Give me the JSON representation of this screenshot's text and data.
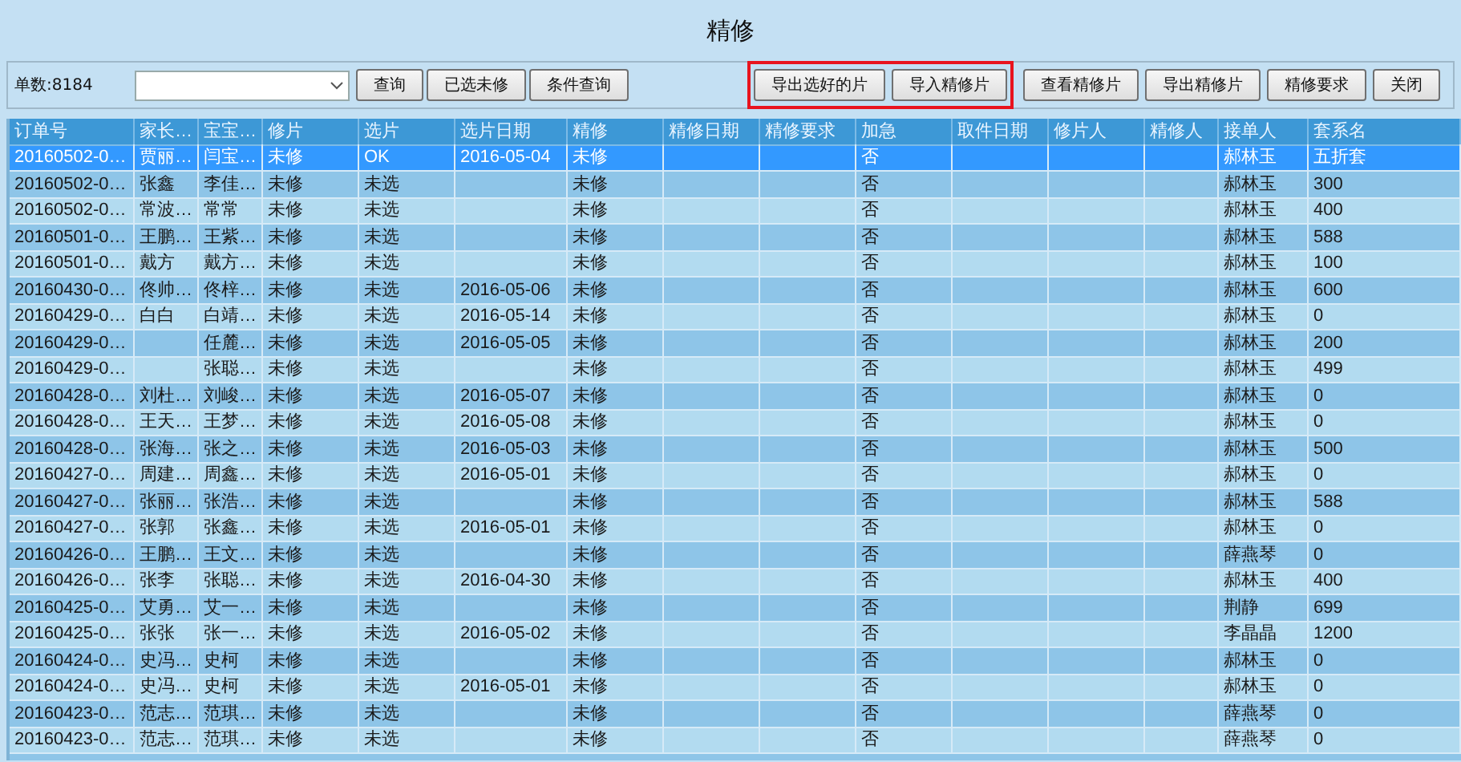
{
  "window": {
    "title": "精修"
  },
  "toolbar": {
    "count_label": "单数:8184",
    "left_buttons": [
      "查询",
      "已选未修",
      "条件查询"
    ],
    "right_groups": [
      {
        "highlighted": true,
        "buttons": [
          "导出选好的片",
          "导入精修片"
        ]
      },
      {
        "highlighted": false,
        "buttons": [
          "查看精修片",
          "导出精修片",
          "精修要求",
          "关闭"
        ]
      }
    ]
  },
  "table": {
    "columns": [
      "订单号",
      "家长…",
      "宝宝…",
      "修片",
      "选片",
      "选片日期",
      "精修",
      "精修日期",
      "精修要求",
      "加急",
      "取件日期",
      "修片人",
      "精修人",
      "接单人",
      "套系名"
    ],
    "rows": [
      {
        "selected": true,
        "cells": [
          "20160502-0…",
          "贾丽…",
          "闫宝…",
          "未修",
          "OK",
          "2016-05-04",
          "未修",
          null,
          null,
          "否",
          null,
          null,
          null,
          "郝林玉",
          "五折套"
        ]
      },
      {
        "selected": false,
        "cells": [
          "20160502-0…",
          "张鑫",
          "李佳…",
          "未修",
          "未选",
          null,
          "未修",
          null,
          null,
          "否",
          null,
          null,
          null,
          "郝林玉",
          "300"
        ]
      },
      {
        "selected": false,
        "cells": [
          "20160502-0…",
          "常波…",
          "常常",
          "未修",
          "未选",
          null,
          "未修",
          null,
          null,
          "否",
          null,
          null,
          null,
          "郝林玉",
          "400"
        ]
      },
      {
        "selected": false,
        "cells": [
          "20160501-0…",
          "王鹏…",
          "王紫…",
          "未修",
          "未选",
          null,
          "未修",
          null,
          null,
          "否",
          null,
          null,
          null,
          "郝林玉",
          "588"
        ]
      },
      {
        "selected": false,
        "cells": [
          "20160501-0…",
          "戴方",
          "戴方…",
          "未修",
          "未选",
          null,
          "未修",
          null,
          null,
          "否",
          null,
          null,
          null,
          "郝林玉",
          "100"
        ]
      },
      {
        "selected": false,
        "cells": [
          "20160430-0…",
          "佟帅…",
          "佟梓…",
          "未修",
          "未选",
          "2016-05-06",
          "未修",
          null,
          null,
          "否",
          null,
          null,
          null,
          "郝林玉",
          "600"
        ]
      },
      {
        "selected": false,
        "cells": [
          "20160429-0…",
          "白白",
          "白靖…",
          "未修",
          "未选",
          "2016-05-14",
          "未修",
          null,
          null,
          "否",
          null,
          null,
          null,
          "郝林玉",
          "0"
        ]
      },
      {
        "selected": false,
        "cells": [
          "20160429-0…",
          null,
          "任麓…",
          "未修",
          "未选",
          "2016-05-05",
          "未修",
          null,
          null,
          "否",
          null,
          null,
          null,
          "郝林玉",
          "200"
        ]
      },
      {
        "selected": false,
        "cells": [
          "20160429-0…",
          null,
          "张聪…",
          "未修",
          "未选",
          null,
          "未修",
          null,
          null,
          "否",
          null,
          null,
          null,
          "郝林玉",
          "499"
        ]
      },
      {
        "selected": false,
        "cells": [
          "20160428-0…",
          "刘杜…",
          "刘峻…",
          "未修",
          "未选",
          "2016-05-07",
          "未修",
          null,
          null,
          "否",
          null,
          null,
          null,
          "郝林玉",
          "0"
        ]
      },
      {
        "selected": false,
        "cells": [
          "20160428-0…",
          "王天…",
          "王梦…",
          "未修",
          "未选",
          "2016-05-08",
          "未修",
          null,
          null,
          "否",
          null,
          null,
          null,
          "郝林玉",
          "0"
        ]
      },
      {
        "selected": false,
        "cells": [
          "20160428-0…",
          "张海…",
          "张之…",
          "未修",
          "未选",
          "2016-05-03",
          "未修",
          null,
          null,
          "否",
          null,
          null,
          null,
          "郝林玉",
          "500"
        ]
      },
      {
        "selected": false,
        "cells": [
          "20160427-0…",
          "周建…",
          "周鑫…",
          "未修",
          "未选",
          "2016-05-01",
          "未修",
          null,
          null,
          "否",
          null,
          null,
          null,
          "郝林玉",
          "0"
        ]
      },
      {
        "selected": false,
        "cells": [
          "20160427-0…",
          "张丽…",
          "张浩…",
          "未修",
          "未选",
          null,
          "未修",
          null,
          null,
          "否",
          null,
          null,
          null,
          "郝林玉",
          "588"
        ]
      },
      {
        "selected": false,
        "cells": [
          "20160427-0…",
          "张郭",
          "张鑫…",
          "未修",
          "未选",
          "2016-05-01",
          "未修",
          null,
          null,
          "否",
          null,
          null,
          null,
          "郝林玉",
          "0"
        ]
      },
      {
        "selected": false,
        "cells": [
          "20160426-0…",
          "王鹏…",
          "王文…",
          "未修",
          "未选",
          null,
          "未修",
          null,
          null,
          "否",
          null,
          null,
          null,
          "薛燕琴",
          "0"
        ]
      },
      {
        "selected": false,
        "cells": [
          "20160426-0…",
          "张李",
          "张聪…",
          "未修",
          "未选",
          "2016-04-30",
          "未修",
          null,
          null,
          "否",
          null,
          null,
          null,
          "郝林玉",
          "400"
        ]
      },
      {
        "selected": false,
        "cells": [
          "20160425-0…",
          "艾勇…",
          "艾一…",
          "未修",
          "未选",
          null,
          "未修",
          null,
          null,
          "否",
          null,
          null,
          null,
          "荆静",
          "699"
        ]
      },
      {
        "selected": false,
        "cells": [
          "20160425-0…",
          "张张",
          "张一…",
          "未修",
          "未选",
          "2016-05-02",
          "未修",
          null,
          null,
          "否",
          null,
          null,
          null,
          "李晶晶",
          "1200"
        ]
      },
      {
        "selected": false,
        "cells": [
          "20160424-0…",
          "史冯…",
          "史柯",
          "未修",
          "未选",
          null,
          "未修",
          null,
          null,
          "否",
          null,
          null,
          null,
          "郝林玉",
          "0"
        ]
      },
      {
        "selected": false,
        "cells": [
          "20160424-0…",
          "史冯…",
          "史柯",
          "未修",
          "未选",
          "2016-05-01",
          "未修",
          null,
          null,
          "否",
          null,
          null,
          null,
          "郝林玉",
          "0"
        ]
      },
      {
        "selected": false,
        "cells": [
          "20160423-0…",
          "范志…",
          "范琪…",
          "未修",
          "未选",
          null,
          "未修",
          null,
          null,
          "否",
          null,
          null,
          null,
          "薛燕琴",
          "0"
        ]
      },
      {
        "selected": false,
        "cells": [
          "20160423-0…",
          "范志…",
          "范琪…",
          "未修",
          "未选",
          null,
          "未修",
          null,
          null,
          "否",
          null,
          null,
          null,
          "薛燕琴",
          "0"
        ]
      }
    ]
  }
}
